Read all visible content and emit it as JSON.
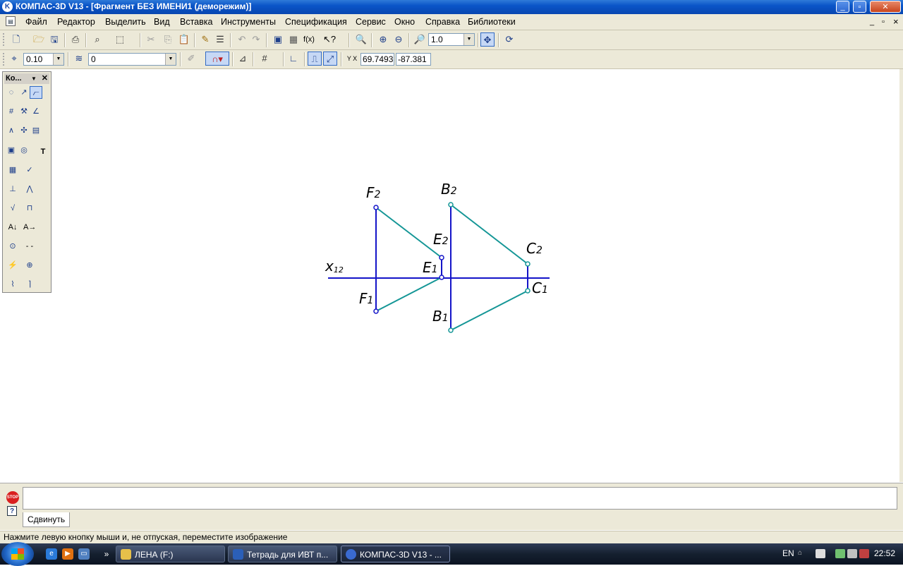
{
  "window": {
    "title": "КОМПАС-3D V13 - [Фрагмент БЕЗ ИМЕНИ1 (деморежим)]",
    "controls": {
      "minimize": "_",
      "maximize": "▫",
      "close": "✕"
    }
  },
  "menu": {
    "items": [
      "Файл",
      "Редактор",
      "Выделить",
      "Вид",
      "Вставка",
      "Инструменты",
      "Спецификация",
      "Сервис",
      "Окно",
      "Справка",
      "Библиотеки"
    ],
    "doc_controls": {
      "minimize": "_",
      "restore": "▫",
      "close": "×"
    }
  },
  "toolbar_view": {
    "zoom_value": "1.0"
  },
  "toolbar_params": {
    "step_value": "0.10",
    "layer_value": "0",
    "coord_x": "69.7493",
    "coord_y": "-87.381"
  },
  "compact_panel": {
    "title": "Ко...",
    "close": "✕"
  },
  "drawing": {
    "axis_label": "x",
    "axis_sub": "12",
    "labels": [
      {
        "main": "F",
        "sub": "2"
      },
      {
        "main": "B",
        "sub": "2"
      },
      {
        "main": "E",
        "sub": "2"
      },
      {
        "main": "C",
        "sub": "2"
      },
      {
        "main": "E",
        "sub": "1"
      },
      {
        "main": "C",
        "sub": "1"
      },
      {
        "main": "F",
        "sub": "1"
      },
      {
        "main": "B",
        "sub": "1"
      }
    ],
    "colors": {
      "axis": "#1414c8",
      "teal": "#149696"
    }
  },
  "command_panel": {
    "stop_text": "STOP",
    "tab_label": "Сдвинуть"
  },
  "status_bar": {
    "text": "Нажмите левую кнопку мыши и, не отпуская, переместите изображение"
  },
  "taskbar": {
    "tasks": [
      {
        "label": "ЛЕНА (F:)"
      },
      {
        "label": "Тетрадь для ИВТ п..."
      },
      {
        "label": "КОМПАС-3D V13 - ..."
      }
    ],
    "language": "EN",
    "clock": "22:52"
  }
}
